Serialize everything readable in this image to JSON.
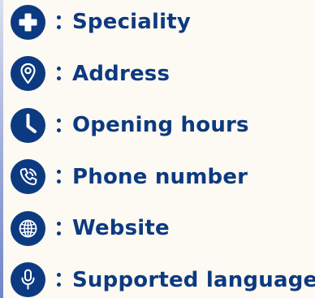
{
  "colors": {
    "primary": "#0c3a80",
    "background": "#fdf9f3"
  },
  "legend": {
    "items": [
      {
        "icon": "medical-cross-icon",
        "label": "Speciality"
      },
      {
        "icon": "location-pin-icon",
        "label": "Address"
      },
      {
        "icon": "clock-icon",
        "label": "Opening hours"
      },
      {
        "icon": "phone-icon",
        "label": "Phone number"
      },
      {
        "icon": "globe-icon",
        "label": "Website"
      },
      {
        "icon": "microphone-icon",
        "label": "Supported language"
      }
    ]
  }
}
